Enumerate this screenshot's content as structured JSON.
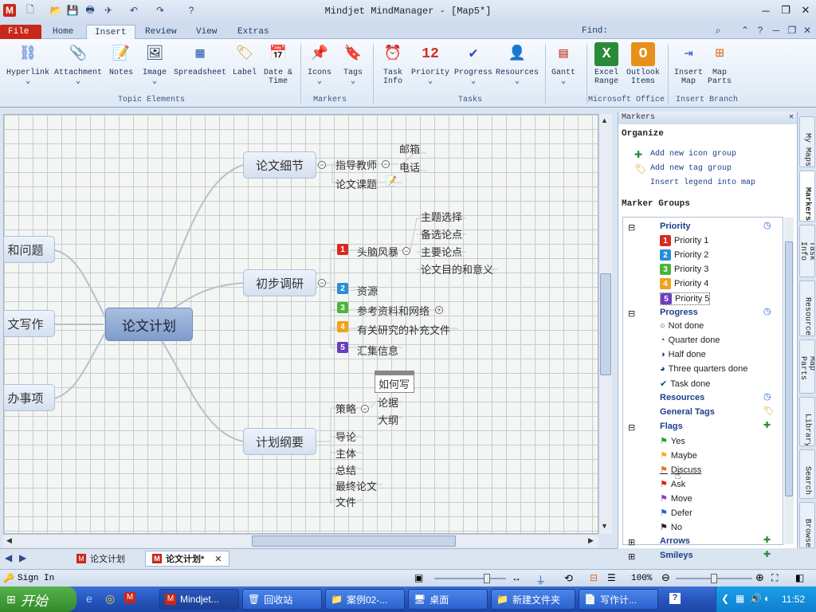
{
  "window": {
    "title": "Mindjet MindManager - [Map5*]"
  },
  "ribbon_tabs": [
    "File",
    "Home",
    "Insert",
    "Review",
    "View",
    "Extras"
  ],
  "find_label": "Find:",
  "ribbon": {
    "hyperlink": "Hyperlink",
    "attachment": "Attachment",
    "notes": "Notes",
    "image": "Image",
    "spreadsheet": "Spreadsheet",
    "label": "Label",
    "date_time_1": "Date &",
    "date_time_2": "Time",
    "icons": "Icons",
    "tags": "Tags",
    "task_info_1": "Task",
    "task_info_2": "Info",
    "priority": "Priority",
    "progress": "Progress",
    "resources": "Resources",
    "gantt": "Gantt",
    "excel_1": "Excel",
    "excel_2": "Range",
    "outlook_1": "Outlook",
    "outlook_2": "Items",
    "insert_map_1": "Insert",
    "insert_map_2": "Map",
    "map_parts_1": "Map",
    "map_parts_2": "Parts",
    "group_topic_elements": "Topic Elements",
    "group_markers": "Markers",
    "group_tasks": "Tasks",
    "group_office": "Microsoft Office",
    "group_branch": "Insert Branch"
  },
  "map": {
    "central": "论文计划",
    "left_topics": [
      "和问题",
      "文写作",
      "办事项"
    ],
    "t1": "论文细节",
    "t1_a": "指导教师",
    "t1_a1": "邮箱",
    "t1_a2": "电话",
    "t1_b": "论文课题",
    "t2": "初步调研",
    "t2_a": "头脑风暴",
    "t2_a1": "主题选择",
    "t2_a2": "备选论点",
    "t2_a3": "主要论点",
    "t2_a4": "论文目的和意义",
    "t2_b": "资源",
    "t2_c": "参考资料和网络",
    "t2_d": "有关研究的补充文件",
    "t2_e": "汇集信息",
    "t3": "计划纲要",
    "t3_a": "策略",
    "t3_a1": "论据",
    "t3_a2": "大纲",
    "t3_note": "如何写",
    "t3_b": "导论",
    "t3_c": "主体",
    "t3_d": "总结",
    "t3_e": "最终论文",
    "t3_f": "文件",
    "prio_nums": [
      "1",
      "2",
      "3",
      "4",
      "5"
    ]
  },
  "doc_tabs": [
    "论文计划",
    "论文计划*"
  ],
  "panel": {
    "title": "Markers",
    "organize": "Organize",
    "add_icon_group": "Add new icon group",
    "add_tag_group": "Add new tag group",
    "insert_legend": "Insert legend into map",
    "marker_groups": "Marker Groups",
    "priority": "Priority",
    "priority_items": [
      "Priority 1",
      "Priority 2",
      "Priority 3",
      "Priority 4",
      "Priority 5"
    ],
    "progress": "Progress",
    "progress_items": [
      "Not done",
      "Quarter done",
      "Half done",
      "Three quarters done",
      "Task done"
    ],
    "resources": "Resources",
    "general_tags": "General Tags",
    "flags": "Flags",
    "flag_items": [
      "Yes",
      "Maybe",
      "Discuss",
      "Ask",
      "Move",
      "Defer",
      "No"
    ],
    "arrows": "Arrows",
    "smileys": "Smileys"
  },
  "side_tabs": [
    "My Maps",
    "Markers",
    "Task Info",
    "Resources",
    "Map Parts",
    "Library",
    "Search",
    "Browser"
  ],
  "status": {
    "sign_in": "Sign In",
    "zoom": "100%"
  },
  "taskbar": {
    "start": "开始",
    "buttons": [
      "Mindjet...",
      "回收站",
      "案例02-...",
      "桌面",
      "新建文件夹",
      "写作计..."
    ],
    "clock": "11:52"
  },
  "colors": {
    "prio1": "#d62b1f",
    "prio2": "#2a8ed6",
    "prio3": "#4bb43a",
    "prio4": "#f0a21a",
    "prio5": "#6a3fbf",
    "flag_yes": "#2aa02a",
    "flag_maybe": "#f0b020",
    "flag_discuss": "#e8701a",
    "flag_ask": "#d62020",
    "flag_move": "#8a3fc8",
    "flag_defer": "#2a62c8",
    "flag_no": "#222222"
  }
}
